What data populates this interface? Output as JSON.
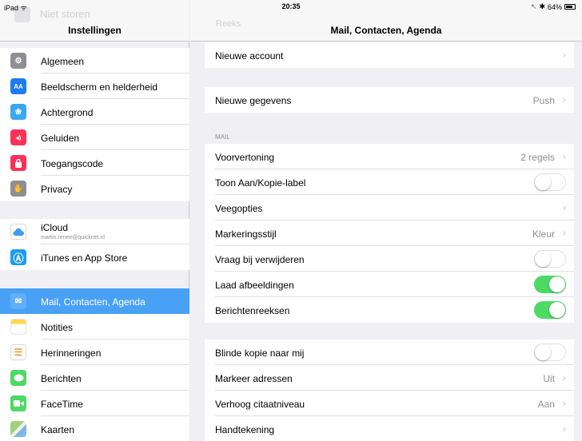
{
  "status_bar": {
    "device": "iPad",
    "time": "20:35",
    "battery": "64%"
  },
  "sidebar": {
    "title": "Instellingen",
    "ghost_label": "Niet storen",
    "items": [
      {
        "label": "Algemeen",
        "icon": "gear-icon",
        "color": "#8e8e93",
        "glyph": "⚙"
      },
      {
        "label": "Beeldscherm en helderheid",
        "icon": "display-icon",
        "color": "#1d7cf2",
        "glyph": "AA"
      },
      {
        "label": "Achtergrond",
        "icon": "wallpaper-icon",
        "color": "#3aa7f0",
        "glyph": "❀"
      },
      {
        "label": "Geluiden",
        "icon": "sound-icon",
        "color": "#fc3158",
        "glyph": "◂)"
      },
      {
        "label": "Toegangscode",
        "icon": "lock-icon",
        "color": "#fc3158",
        "glyph": "🔒"
      },
      {
        "label": "Privacy",
        "icon": "hand-icon",
        "color": "#8e8e93",
        "glyph": "✋"
      },
      {
        "label": "iCloud",
        "sublabel": "martin.renee@quicknet.nl",
        "icon": "icloud-icon",
        "color": "#ffffff",
        "glyph": "☁"
      },
      {
        "label": "iTunes en App Store",
        "icon": "appstore-icon",
        "color": "#1d9bf0",
        "glyph": "Ⓐ"
      },
      {
        "label": "Mail, Contacten, Agenda",
        "icon": "mail-icon",
        "color": "#4aa0f6",
        "glyph": "✉"
      },
      {
        "label": "Notities",
        "icon": "notes-icon",
        "color": "#ffd84a",
        "glyph": ""
      },
      {
        "label": "Herinneringen",
        "icon": "reminders-icon",
        "color": "#ffffff",
        "glyph": "☰"
      },
      {
        "label": "Berichten",
        "icon": "messages-icon",
        "color": "#4cd964",
        "glyph": "💬"
      },
      {
        "label": "FaceTime",
        "icon": "facetime-icon",
        "color": "#4cd964",
        "glyph": "■"
      },
      {
        "label": "Kaarten",
        "icon": "maps-icon",
        "color": "#c7d8a8",
        "glyph": "▞"
      }
    ]
  },
  "main": {
    "title": "Mail, Contacten, Agenda",
    "ghost_label": "Reeks",
    "accounts": {
      "new_account": "Nieuwe account"
    },
    "fetch": {
      "label": "Nieuwe gegevens",
      "value": "Push"
    },
    "mail_section": "MAIL",
    "mail_rows": [
      {
        "label": "Voorvertoning",
        "value": "2 regels",
        "kind": "chevron"
      },
      {
        "label": "Toon Aan/Kopie-label",
        "kind": "toggle",
        "on": false
      },
      {
        "label": "Veegopties",
        "value": "",
        "kind": "chevron"
      },
      {
        "label": "Markeringsstijl",
        "value": "Kleur",
        "kind": "chevron"
      },
      {
        "label": "Vraag bij verwijderen",
        "kind": "toggle",
        "on": false
      },
      {
        "label": "Laad afbeeldingen",
        "kind": "toggle",
        "on": true
      },
      {
        "label": "Berichtenreeksen",
        "kind": "toggle",
        "on": true
      }
    ],
    "compose_rows": [
      {
        "label": "Blinde kopie naar mij",
        "kind": "toggle",
        "on": false
      },
      {
        "label": "Markeer adressen",
        "value": "Uit",
        "kind": "chevron"
      },
      {
        "label": "Verhoog citaatniveau",
        "value": "Aan",
        "kind": "chevron"
      },
      {
        "label": "Handtekening",
        "value": "",
        "kind": "chevron"
      }
    ]
  }
}
